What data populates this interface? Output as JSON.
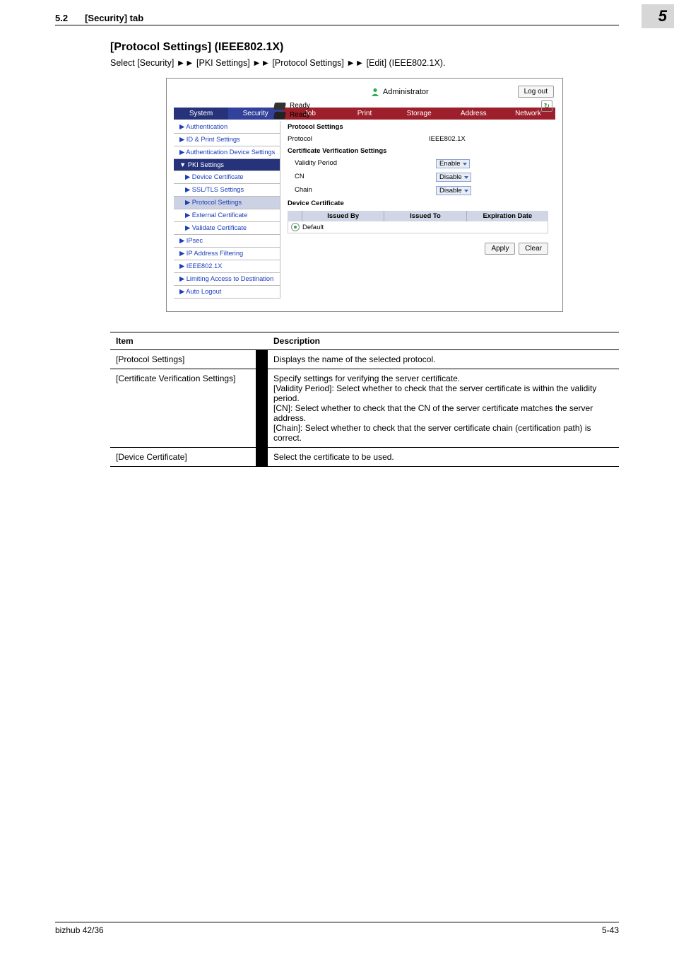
{
  "header": {
    "section_number": "5.2",
    "section_title": "[Security] tab",
    "chapter": "5"
  },
  "page": {
    "title": "[Protocol Settings] (IEEE802.1X)",
    "breadcrumb": "Select [Security] ►► [PKI Settings] ►► [Protocol Settings] ►► [Edit] (IEEE802.1X)."
  },
  "screenshot": {
    "user": "Administrator",
    "logout": "Log out",
    "status1": "Ready",
    "status2": "Ready",
    "tabs": {
      "system": "System",
      "security": "Security",
      "job": "Job",
      "print": "Print",
      "storage": "Storage",
      "address": "Address",
      "network": "Network"
    },
    "nav": {
      "authentication": "▶ Authentication",
      "id_print": "▶ ID & Print Settings",
      "auth_dev": "▶ Authentication Device Settings",
      "pki": "▼ PKI Settings",
      "dev_cert": "▶ Device Certificate",
      "ssl": "▶ SSL/TLS Settings",
      "proto": "▶ Protocol Settings",
      "ext_cert": "▶ External Certificate",
      "val_cert": "▶ Validate Certificate",
      "ipsec": "▶ IPsec",
      "ip_filter": "▶ IP Address Filtering",
      "ieee": "▶ IEEE802.1X",
      "limit": "▶ Limiting Access to Destination",
      "auto_logout": "▶ Auto Logout"
    },
    "panel": {
      "heading": "Protocol Settings",
      "protocol_label": "Protocol",
      "protocol_value": "IEEE802.1X",
      "cvs_heading": "Certificate Verification Settings",
      "validity_label": "Validity Period",
      "validity_value": "Enable",
      "cn_label": "CN",
      "cn_value": "Disable",
      "chain_label": "Chain",
      "chain_value": "Disable",
      "dc_heading": "Device Certificate",
      "col_issued_by": "Issued By",
      "col_issued_to": "Issued To",
      "col_exp": "Expiration Date",
      "default_cert": "Default",
      "apply": "Apply",
      "clear": "Clear"
    }
  },
  "table": {
    "h_item": "Item",
    "h_desc": "Description",
    "rows": [
      {
        "item": "[Protocol Settings]",
        "desc": "Displays the name of the selected protocol."
      },
      {
        "item": "[Certificate Verification Settings]",
        "desc": "Specify settings for verifying the server certificate.\n[Validity Period]: Select whether to check that the server certificate is within the validity period.\n[CN]: Select whether to check that the CN of the server certificate matches the server address.\n[Chain]: Select whether to check that the server certificate chain (certification path) is correct."
      },
      {
        "item": "[Device Certificate]",
        "desc": "Select the certificate to be used."
      }
    ]
  },
  "footer": {
    "left": "bizhub 42/36",
    "right": "5-43"
  }
}
